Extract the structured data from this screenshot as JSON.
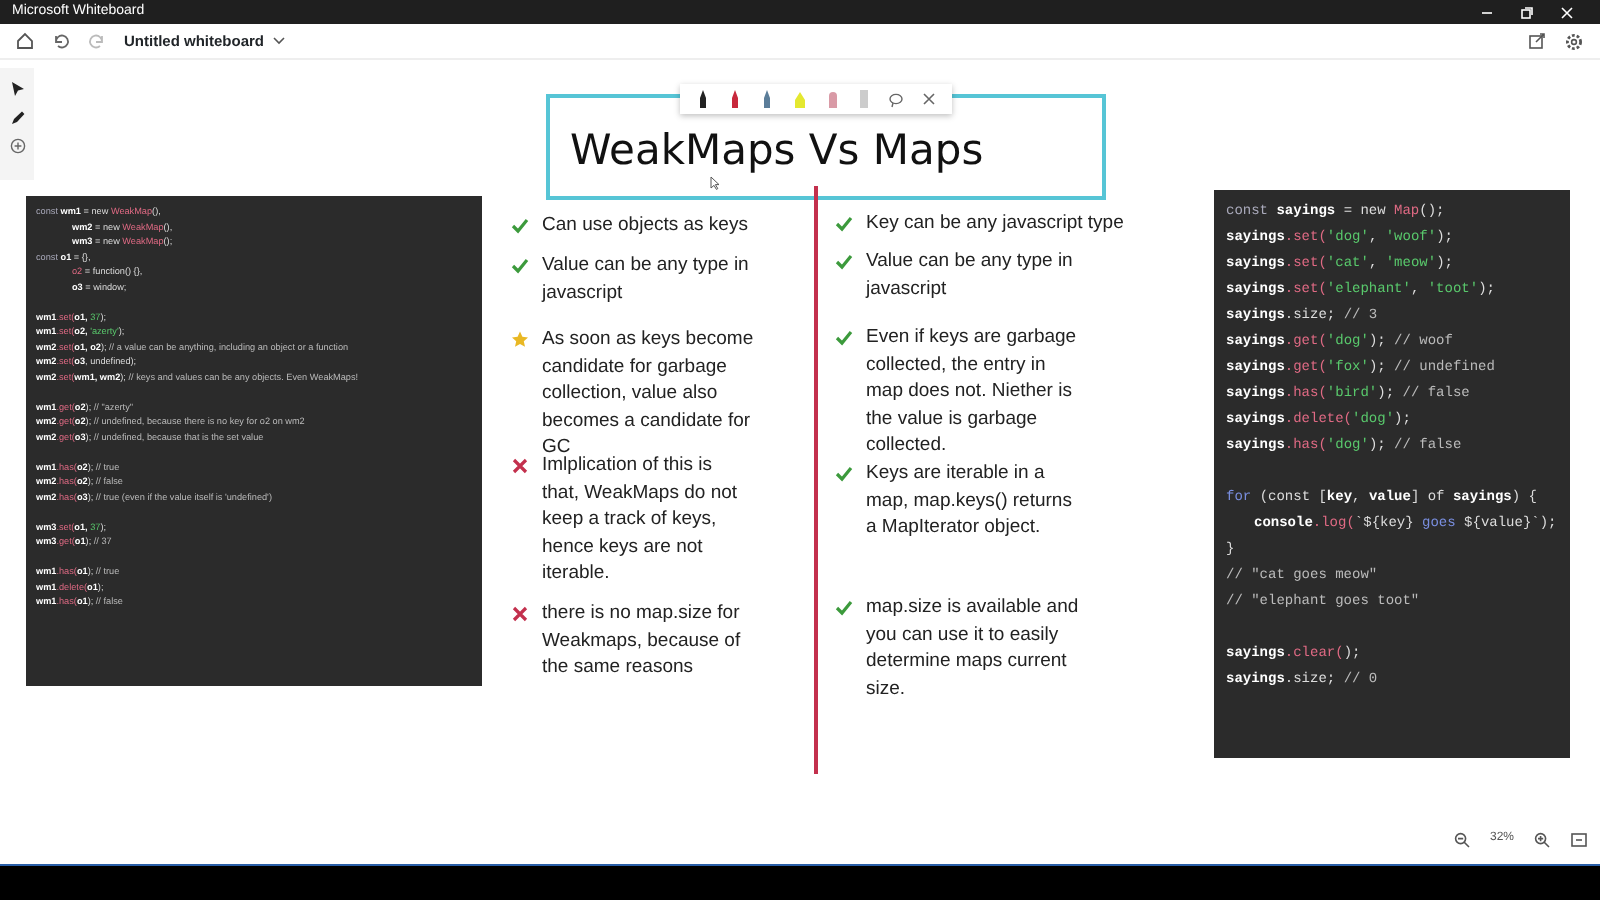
{
  "window": {
    "title": "Microsoft Whiteboard"
  },
  "toolbar": {
    "board_name": "Untitled whiteboard"
  },
  "board": {
    "title": "WeakMaps Vs Maps",
    "left_code": [
      {
        "tokens": [
          {
            "kind": "kw",
            "text": "const "
          },
          {
            "kind": "nm",
            "text": "wm1"
          },
          {
            "kind": "pl",
            "text": " = new "
          },
          {
            "kind": "fn",
            "text": "WeakMap"
          },
          {
            "kind": "pl",
            "text": "(),"
          }
        ]
      },
      {
        "indent": true,
        "tokens": [
          {
            "kind": "nm",
            "text": "wm2"
          },
          {
            "kind": "pl",
            "text": " = new "
          },
          {
            "kind": "fn",
            "text": "WeakMap"
          },
          {
            "kind": "pl",
            "text": "(),"
          }
        ]
      },
      {
        "indent": true,
        "tokens": [
          {
            "kind": "nm",
            "text": "wm3"
          },
          {
            "kind": "pl",
            "text": " = new "
          },
          {
            "kind": "fn",
            "text": "WeakMap"
          },
          {
            "kind": "pl",
            "text": "();"
          }
        ]
      },
      {
        "tokens": [
          {
            "kind": "kw",
            "text": "const "
          },
          {
            "kind": "nm",
            "text": "o1"
          },
          {
            "kind": "pl",
            "text": " = {},"
          }
        ]
      },
      {
        "indent": true,
        "tokens": [
          {
            "kind": "fn",
            "text": "o2"
          },
          {
            "kind": "pl",
            "text": " = function() {},"
          }
        ]
      },
      {
        "indent": true,
        "tokens": [
          {
            "kind": "nm",
            "text": "o3"
          },
          {
            "kind": "pl",
            "text": " = window;"
          }
        ]
      },
      {
        "gap": true,
        "tokens": [
          {
            "kind": "nm",
            "text": "wm1"
          },
          {
            "kind": "fn",
            "text": ".set("
          },
          {
            "kind": "nm",
            "text": "o1, "
          },
          {
            "kind": "str",
            "text": "37"
          },
          {
            "kind": "pl",
            "text": ");"
          }
        ]
      },
      {
        "tokens": [
          {
            "kind": "nm",
            "text": "wm1"
          },
          {
            "kind": "fn",
            "text": ".set("
          },
          {
            "kind": "nm",
            "text": "o2, "
          },
          {
            "kind": "str",
            "text": "'azerty'"
          },
          {
            "kind": "pl",
            "text": ");"
          }
        ]
      },
      {
        "tokens": [
          {
            "kind": "nm",
            "text": "wm2"
          },
          {
            "kind": "fn",
            "text": ".set("
          },
          {
            "kind": "nm",
            "text": "o1, o2"
          },
          {
            "kind": "pl",
            "text": "); "
          },
          {
            "kind": "cm",
            "text": "// a value can be anything, including an object or a function"
          }
        ]
      },
      {
        "tokens": [
          {
            "kind": "nm",
            "text": "wm2"
          },
          {
            "kind": "fn",
            "text": ".set("
          },
          {
            "kind": "nm",
            "text": "o3"
          },
          {
            "kind": "pl",
            "text": ", undefined);"
          }
        ]
      },
      {
        "tokens": [
          {
            "kind": "nm",
            "text": "wm2"
          },
          {
            "kind": "fn",
            "text": ".set("
          },
          {
            "kind": "nm",
            "text": "wm1, wm2"
          },
          {
            "kind": "pl",
            "text": "); "
          },
          {
            "kind": "cm",
            "text": "// keys and values can be any objects. Even WeakMaps!"
          }
        ]
      },
      {
        "gap": true,
        "tokens": [
          {
            "kind": "nm",
            "text": "wm1"
          },
          {
            "kind": "fn",
            "text": ".get("
          },
          {
            "kind": "nm",
            "text": "o2"
          },
          {
            "kind": "pl",
            "text": "); "
          },
          {
            "kind": "cm",
            "text": "// \"azerty\""
          }
        ]
      },
      {
        "tokens": [
          {
            "kind": "nm",
            "text": "wm2"
          },
          {
            "kind": "fn",
            "text": ".get("
          },
          {
            "kind": "nm",
            "text": "o2"
          },
          {
            "kind": "pl",
            "text": "); "
          },
          {
            "kind": "cm",
            "text": "// undefined, because there is no key for o2 on wm2"
          }
        ]
      },
      {
        "tokens": [
          {
            "kind": "nm",
            "text": "wm2"
          },
          {
            "kind": "fn",
            "text": ".get("
          },
          {
            "kind": "nm",
            "text": "o3"
          },
          {
            "kind": "pl",
            "text": "); "
          },
          {
            "kind": "cm",
            "text": "// undefined, because that is the set value"
          }
        ]
      },
      {
        "gap": true,
        "tokens": [
          {
            "kind": "nm",
            "text": "wm1"
          },
          {
            "kind": "fn",
            "text": ".has("
          },
          {
            "kind": "nm",
            "text": "o2"
          },
          {
            "kind": "pl",
            "text": "); "
          },
          {
            "kind": "cm",
            "text": "// true"
          }
        ]
      },
      {
        "tokens": [
          {
            "kind": "nm",
            "text": "wm2"
          },
          {
            "kind": "fn",
            "text": ".has("
          },
          {
            "kind": "nm",
            "text": "o2"
          },
          {
            "kind": "pl",
            "text": "); "
          },
          {
            "kind": "cm",
            "text": "// false"
          }
        ]
      },
      {
        "tokens": [
          {
            "kind": "nm",
            "text": "wm2"
          },
          {
            "kind": "fn",
            "text": ".has("
          },
          {
            "kind": "nm",
            "text": "o3"
          },
          {
            "kind": "pl",
            "text": "); "
          },
          {
            "kind": "cm",
            "text": "// true (even if the value itself is 'undefined')"
          }
        ]
      },
      {
        "gap": true,
        "tokens": [
          {
            "kind": "nm",
            "text": "wm3"
          },
          {
            "kind": "fn",
            "text": ".set("
          },
          {
            "kind": "nm",
            "text": "o1, "
          },
          {
            "kind": "str",
            "text": "37"
          },
          {
            "kind": "pl",
            "text": ");"
          }
        ]
      },
      {
        "tokens": [
          {
            "kind": "nm",
            "text": "wm3"
          },
          {
            "kind": "fn",
            "text": ".get("
          },
          {
            "kind": "nm",
            "text": "o1"
          },
          {
            "kind": "pl",
            "text": "); "
          },
          {
            "kind": "cm",
            "text": "// 37"
          }
        ]
      },
      {
        "gap": true,
        "tokens": [
          {
            "kind": "nm",
            "text": "wm1"
          },
          {
            "kind": "fn",
            "text": ".has("
          },
          {
            "kind": "nm",
            "text": "o1"
          },
          {
            "kind": "pl",
            "text": "); "
          },
          {
            "kind": "cm",
            "text": "// true"
          }
        ]
      },
      {
        "tokens": [
          {
            "kind": "nm",
            "text": "wm1"
          },
          {
            "kind": "fn",
            "text": ".delete("
          },
          {
            "kind": "nm",
            "text": "o1"
          },
          {
            "kind": "pl",
            "text": ");"
          }
        ]
      },
      {
        "tokens": [
          {
            "kind": "nm",
            "text": "wm1"
          },
          {
            "kind": "fn",
            "text": ".has("
          },
          {
            "kind": "nm",
            "text": "o1"
          },
          {
            "kind": "pl",
            "text": "); "
          },
          {
            "kind": "cm",
            "text": "// false"
          }
        ]
      }
    ],
    "left_points": [
      {
        "kind": "check",
        "lines": [
          "Can use objects as keys"
        ]
      },
      {
        "kind": "check",
        "lines": [
          "Value can be any type in",
          "javascript"
        ]
      },
      {
        "kind": "star",
        "lines": [
          "As soon as keys become",
          "candidate for garbage",
          "collection, value also",
          "becomes a candidate for",
          "GC"
        ]
      },
      {
        "kind": "cross",
        "lines": [
          "Imlplication of this is",
          "that, WeakMaps do not",
          "keep a track of keys,",
          "hence keys are not",
          "iterable."
        ]
      },
      {
        "kind": "cross",
        "lines": [
          "there is no map.size for",
          "Weakmaps, because of",
          "the same reasons"
        ]
      }
    ],
    "right_points": [
      {
        "kind": "check",
        "lines": [
          "Key can be any javascript type"
        ]
      },
      {
        "kind": "check",
        "lines": [
          "Value can be any type in",
          "javascript"
        ]
      },
      {
        "kind": "check",
        "lines": [
          "Even if keys are garbage",
          "collected, the entry in",
          "map does not. Niether is",
          "the value is garbage",
          "collected."
        ]
      },
      {
        "kind": "check",
        "lines": [
          "Keys are iterable in a",
          "map, map.keys() returns",
          "a MapIterator object."
        ]
      },
      {
        "kind": "check",
        "lines": [
          "map.size is available and",
          "you can use it to easily",
          "determine maps current",
          "size."
        ]
      }
    ],
    "right_code": [
      {
        "tokens": [
          {
            "kind": "kw",
            "text": "const "
          },
          {
            "kind": "nm",
            "text": "sayings"
          },
          {
            "kind": "pl",
            "text": " = new "
          },
          {
            "kind": "fn",
            "text": "Map"
          },
          {
            "kind": "pl",
            "text": "();"
          }
        ]
      },
      {
        "tokens": [
          {
            "kind": "nm",
            "text": "sayings"
          },
          {
            "kind": "fn",
            "text": ".set("
          },
          {
            "kind": "str",
            "text": "'dog'"
          },
          {
            "kind": "pl",
            "text": ", "
          },
          {
            "kind": "str",
            "text": "'woof'"
          },
          {
            "kind": "pl",
            "text": ");"
          }
        ]
      },
      {
        "tokens": [
          {
            "kind": "nm",
            "text": "sayings"
          },
          {
            "kind": "fn",
            "text": ".set("
          },
          {
            "kind": "str",
            "text": "'cat'"
          },
          {
            "kind": "pl",
            "text": ", "
          },
          {
            "kind": "str",
            "text": "'meow'"
          },
          {
            "kind": "pl",
            "text": ");"
          }
        ]
      },
      {
        "tokens": [
          {
            "kind": "nm",
            "text": "sayings"
          },
          {
            "kind": "fn",
            "text": ".set("
          },
          {
            "kind": "str",
            "text": "'elephant'"
          },
          {
            "kind": "pl",
            "text": ", "
          },
          {
            "kind": "str",
            "text": "'toot'"
          },
          {
            "kind": "pl",
            "text": ");"
          }
        ]
      },
      {
        "tokens": [
          {
            "kind": "nm",
            "text": "sayings"
          },
          {
            "kind": "pl",
            "text": ".size; "
          },
          {
            "kind": "cm",
            "text": "// 3"
          }
        ]
      },
      {
        "tokens": [
          {
            "kind": "nm",
            "text": "sayings"
          },
          {
            "kind": "fn",
            "text": ".get("
          },
          {
            "kind": "str",
            "text": "'dog'"
          },
          {
            "kind": "pl",
            "text": "); "
          },
          {
            "kind": "cm",
            "text": "// woof"
          }
        ]
      },
      {
        "tokens": [
          {
            "kind": "nm",
            "text": "sayings"
          },
          {
            "kind": "fn",
            "text": ".get("
          },
          {
            "kind": "str",
            "text": "'fox'"
          },
          {
            "kind": "pl",
            "text": "); "
          },
          {
            "kind": "cm",
            "text": "// undefined"
          }
        ]
      },
      {
        "tokens": [
          {
            "kind": "nm",
            "text": "sayings"
          },
          {
            "kind": "fn",
            "text": ".has("
          },
          {
            "kind": "str",
            "text": "'bird'"
          },
          {
            "kind": "pl",
            "text": "); "
          },
          {
            "kind": "cm",
            "text": "// false"
          }
        ]
      },
      {
        "tokens": [
          {
            "kind": "nm",
            "text": "sayings"
          },
          {
            "kind": "fn",
            "text": ".delete("
          },
          {
            "kind": "str",
            "text": "'dog'"
          },
          {
            "kind": "pl",
            "text": ");"
          }
        ]
      },
      {
        "tokens": [
          {
            "kind": "nm",
            "text": "sayings"
          },
          {
            "kind": "fn",
            "text": ".has("
          },
          {
            "kind": "str",
            "text": "'dog'"
          },
          {
            "kind": "pl",
            "text": "); "
          },
          {
            "kind": "cm",
            "text": "// false"
          }
        ]
      },
      {
        "gap": true,
        "tokens": [
          {
            "kind": "kw2",
            "text": "for "
          },
          {
            "kind": "pl",
            "text": "(const ["
          },
          {
            "kind": "nm",
            "text": "key"
          },
          {
            "kind": "pl",
            "text": ", "
          },
          {
            "kind": "nm",
            "text": "value"
          },
          {
            "kind": "pl",
            "text": "] of "
          },
          {
            "kind": "nm",
            "text": "sayings"
          },
          {
            "kind": "pl",
            "text": ") {"
          }
        ]
      },
      {
        "indent": true,
        "tokens": [
          {
            "kind": "nm",
            "text": "console"
          },
          {
            "kind": "fn",
            "text": ".log("
          },
          {
            "kind": "pl",
            "text": "`${key} "
          },
          {
            "kind": "kw2",
            "text": "goes"
          },
          {
            "kind": "pl",
            "text": " ${value}`);"
          }
        ]
      },
      {
        "tokens": [
          {
            "kind": "pl",
            "text": "}"
          }
        ]
      },
      {
        "tokens": [
          {
            "kind": "cm",
            "text": "// \"cat goes meow\""
          }
        ]
      },
      {
        "tokens": [
          {
            "kind": "cm",
            "text": "// \"elephant goes toot\""
          }
        ]
      },
      {
        "gap": true,
        "tokens": [
          {
            "kind": "nm",
            "text": "sayings"
          },
          {
            "kind": "fn",
            "text": ".clear("
          },
          {
            "kind": "pl",
            "text": ");"
          }
        ]
      },
      {
        "tokens": [
          {
            "kind": "nm",
            "text": "sayings"
          },
          {
            "kind": "pl",
            "text": ".size; "
          },
          {
            "kind": "cm",
            "text": "// 0"
          }
        ]
      }
    ]
  },
  "zoom": {
    "reading": "32%"
  }
}
